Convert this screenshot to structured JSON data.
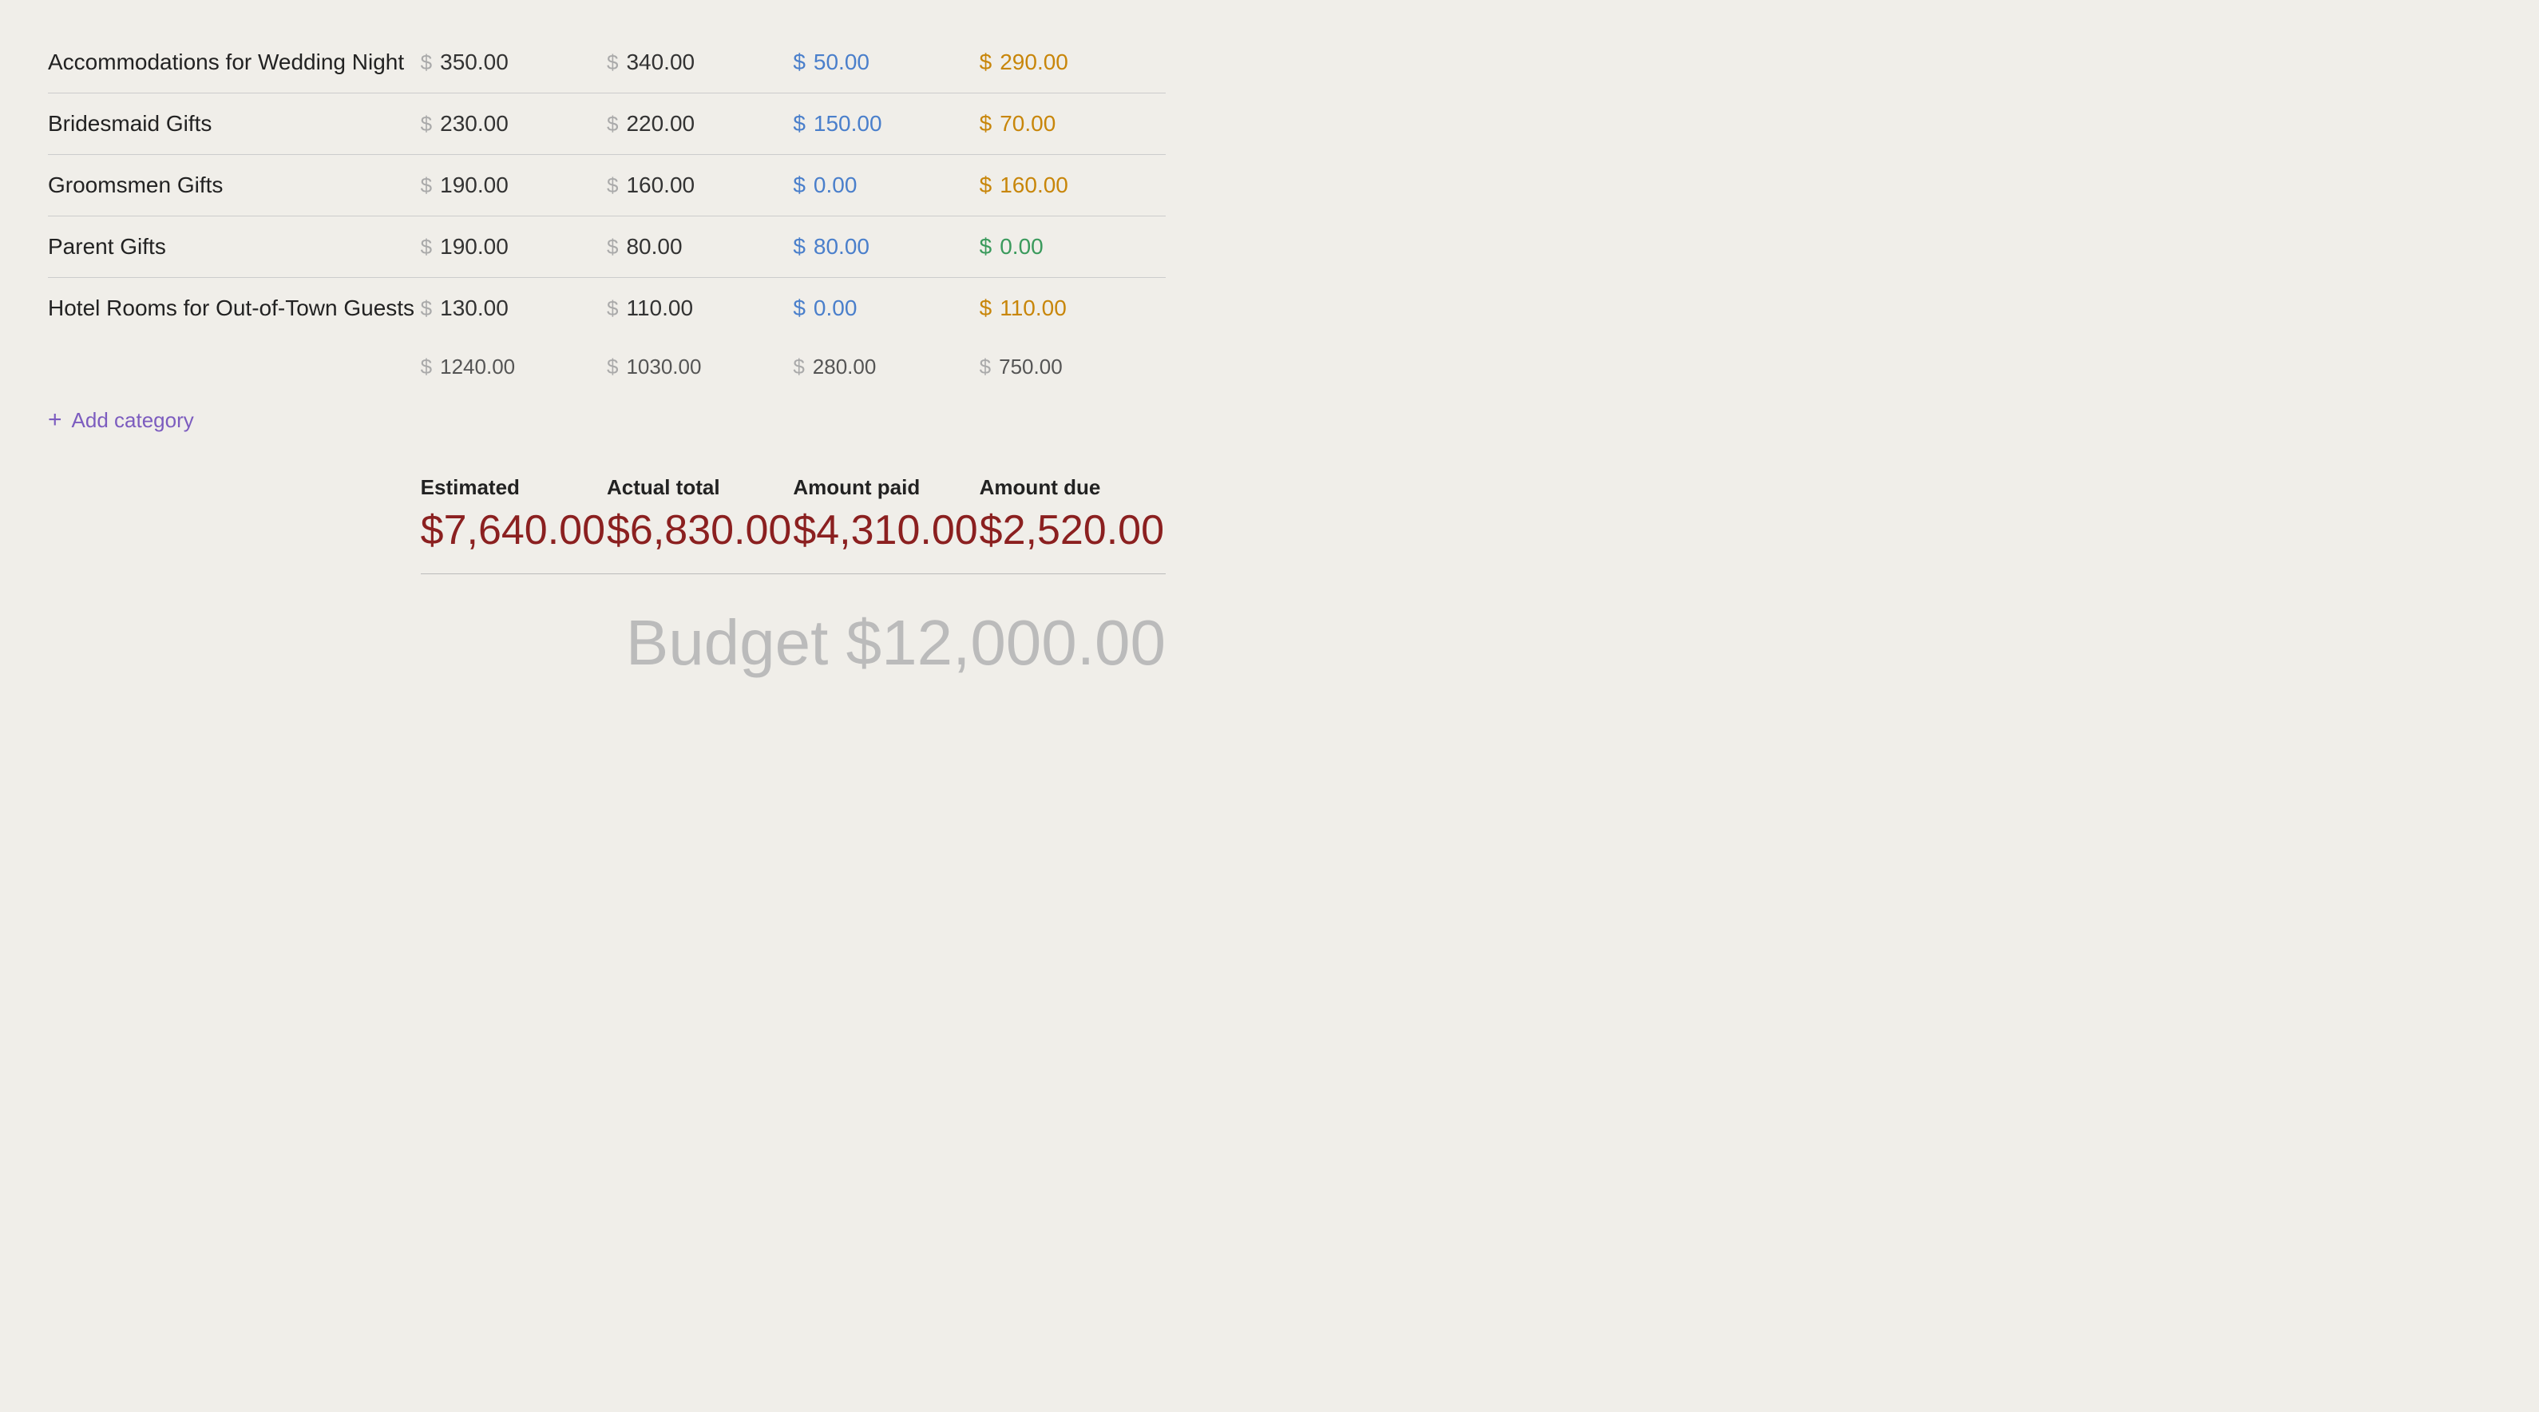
{
  "rows": [
    {
      "name": "Accommodations for Wedding Night",
      "estimated": "350.00",
      "actual": "340.00",
      "paid": "50.00",
      "due": "290.00",
      "paid_color": "blue",
      "due_color": "orange"
    },
    {
      "name": "Bridesmaid Gifts",
      "estimated": "230.00",
      "actual": "220.00",
      "paid": "150.00",
      "due": "70.00",
      "paid_color": "blue",
      "due_color": "orange"
    },
    {
      "name": "Groomsmen Gifts",
      "estimated": "190.00",
      "actual": "160.00",
      "paid": "0.00",
      "due": "160.00",
      "paid_color": "blue",
      "due_color": "orange"
    },
    {
      "name": "Parent Gifts",
      "estimated": "190.00",
      "actual": "80.00",
      "paid": "80.00",
      "due": "0.00",
      "paid_color": "blue",
      "due_color": "green"
    },
    {
      "name": "Hotel Rooms for Out-of-Town Guests",
      "estimated": "130.00",
      "actual": "110.00",
      "paid": "0.00",
      "due": "110.00",
      "paid_color": "blue",
      "due_color": "orange"
    }
  ],
  "subtotals": {
    "estimated": "1240.00",
    "actual": "1030.00",
    "paid": "280.00",
    "due": "750.00"
  },
  "add_category_label": "Add category",
  "summary": {
    "estimated_label": "Estimated",
    "estimated_value": "$7,640.00",
    "actual_label": "Actual total",
    "actual_value": "$6,830.00",
    "paid_label": "Amount paid",
    "paid_value": "$4,310.00",
    "due_label": "Amount due",
    "due_value": "$2,520.00"
  },
  "budget_label": "Budget $12,000.00",
  "colors": {
    "blue": "#4a7fcb",
    "orange": "#c8860a",
    "green": "#3a9a5c",
    "purple": "#7c5cbf",
    "dark_red": "#8b2020"
  }
}
